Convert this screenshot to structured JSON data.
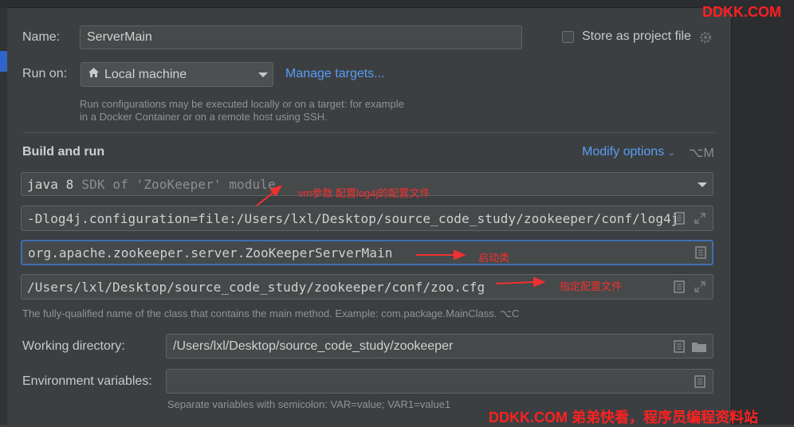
{
  "form": {
    "name_label": "Name:",
    "name_value": "ServerMain",
    "store_label": "Store as project file",
    "run_on_label": "Run on:",
    "run_on_value": "Local machine",
    "manage_targets": "Manage targets...",
    "run_hint_1": "Run configurations may be executed locally or on a target: for example",
    "run_hint_2": "in a Docker Container or on a remote host using SSH."
  },
  "build": {
    "section_title": "Build and run",
    "modify_options": "Modify options",
    "modify_shortcut": "⌥M",
    "jdk_strong": "java 8",
    "jdk_rest": "SDK of 'ZooKeeper' module",
    "vm_options": "-Dlog4j.configuration=file:/Users/lxl/Desktop/source_code_study/zookeeper/conf/log4j",
    "main_class": "org.apache.zookeeper.server.ZooKeeperServerMain",
    "program_args": "/Users/lxl/Desktop/source_code_study/zookeeper/conf/zoo.cfg",
    "main_class_hint": "The fully-qualified name of the class that contains the main method. Example: com.package.MainClass. ⌥C"
  },
  "env": {
    "working_dir_label": "Working directory:",
    "working_dir_value": "/Users/lxl/Desktop/source_code_study/zookeeper",
    "env_vars_label": "Environment variables:",
    "env_vars_value": "",
    "env_hint": "Separate variables with semicolon: VAR=value; VAR1=value1"
  },
  "annotations": {
    "vm_note": "vm参数 配置log4j的配置文件",
    "main_note": "启动类",
    "args_note": "指定配置文件"
  },
  "watermark": {
    "top": "DDKK.COM",
    "bottom": "DDKK.COM 弟弟快看，程序员编程资料站"
  },
  "colors": {
    "background": "#3c3f41",
    "accent_link": "#589df6",
    "focus_border": "#3d6fb4",
    "annotation_red": "#f23030"
  },
  "icons": {
    "store_settings": "gear-icon",
    "run_on_prefix": "home-icon",
    "field_edit": "document-icon",
    "field_expand": "expand-icon",
    "working_dir_browse": "folder-icon"
  }
}
